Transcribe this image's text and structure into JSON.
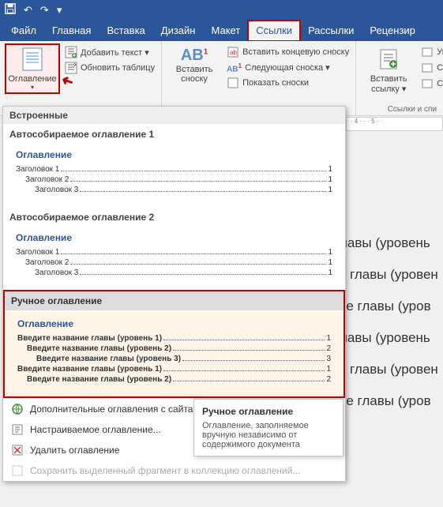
{
  "titlebar": {
    "save": "⌘",
    "undo": "↶",
    "redo": "↷",
    "more": "▾"
  },
  "tabs": {
    "file": "Файл",
    "home": "Главная",
    "insert": "Вставка",
    "design": "Дизайн",
    "layout": "Макет",
    "refs": "Ссылки",
    "mail": "Рассылки",
    "review": "Рецензир"
  },
  "ribbon": {
    "toc": "Оглавление",
    "dd": "▾",
    "add_text": "Добавить текст ▾",
    "update_table": "Обновить таблицу",
    "ab_label": "AB",
    "ab_sup": "1",
    "insert_footnote": "Вставить сноску",
    "insert_endnote": "Вставить концевую сноску",
    "next_footnote": "Следующая сноска ▾",
    "show_notes": "Показать сноски",
    "insert_link": "Вставить ссылку ▾",
    "manage": "Упра",
    "style": "Стиль",
    "biblio": "Спис",
    "group_links": "Ссылки и спи"
  },
  "gallery": {
    "builtin": "Встроенные",
    "auto1": "Автособираемое оглавление 1",
    "auto2": "Автособираемое оглавление 2",
    "manual_head": "Ручное оглавление",
    "toc_heading": "Оглавление",
    "h1": "Заголовок 1",
    "h2": "Заголовок 2",
    "h3": "Заголовок 3",
    "p1": "1",
    "m1": "Введите название главы (уровень 1)",
    "m2": "Введите название главы (уровень 2)",
    "m3": "Введите название главы (уровень 3)",
    "mp1": "1",
    "mp2": "2",
    "mp3": "3",
    "more_online": "Дополнительные оглавления с сайта",
    "custom": "Настраиваемое оглавление...",
    "remove": "Удалить оглавление",
    "save_sel": "Сохранить выделенный фрагмент в коллекцию оглавлений..."
  },
  "tooltip": {
    "title": "Ручное оглавление",
    "body": "Оглавление, заполняемое вручную независимо от содержимого документа"
  },
  "doc": {
    "line": "е главы (уровень",
    "line2": "ние главы (уровен",
    "line3": "ание главы (уров"
  }
}
